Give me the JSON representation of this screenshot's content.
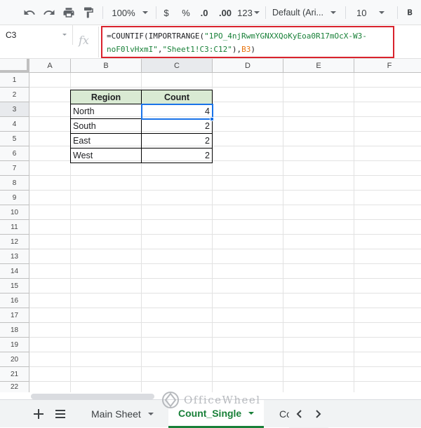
{
  "toolbar": {
    "zoom": "100%",
    "currency": "$",
    "percent": "%",
    "decrease_decimal": ".0",
    "increase_decimal": ".00",
    "more_formats": "123",
    "font": "Default (Ari...",
    "font_size": "10"
  },
  "formula_bar": {
    "name_box": "C3",
    "fx": "fx",
    "formula": {
      "prefix": "=COUNTIF(IMPORTRANGE(",
      "url_part1": "\"1PO_4njRwmYGNXXQoKyEoa0R17mOcX-W3-",
      "url_part2": "noF0lvHxmI\"",
      "comma1": ",",
      "range": "\"Sheet1!C3:C12\"",
      "close": "),",
      "ref": "B3",
      "end": ")"
    }
  },
  "grid": {
    "columns": [
      "A",
      "B",
      "C",
      "D",
      "E",
      "F"
    ],
    "rows": [
      "1",
      "2",
      "3",
      "4",
      "5",
      "6",
      "7",
      "8",
      "9",
      "10",
      "11",
      "12",
      "13",
      "14",
      "15",
      "16",
      "17",
      "18",
      "19",
      "20",
      "21",
      "22"
    ],
    "selected_cell": "C3"
  },
  "table": {
    "headers": [
      "Region",
      "Count"
    ],
    "rows": [
      {
        "region": "North",
        "count": "4"
      },
      {
        "region": "South",
        "count": "2"
      },
      {
        "region": "East",
        "count": "2"
      },
      {
        "region": "West",
        "count": "2"
      }
    ],
    "header_color": "#d9ead3"
  },
  "sheets": {
    "tabs": [
      "Main Sheet",
      "Count_Single",
      "Co"
    ],
    "active": "Count_Single"
  },
  "watermark": "OfficeWheel",
  "colors": {
    "highlight_border": "#d9232d",
    "selection": "#1a73e8",
    "active_tab": "#188038"
  }
}
